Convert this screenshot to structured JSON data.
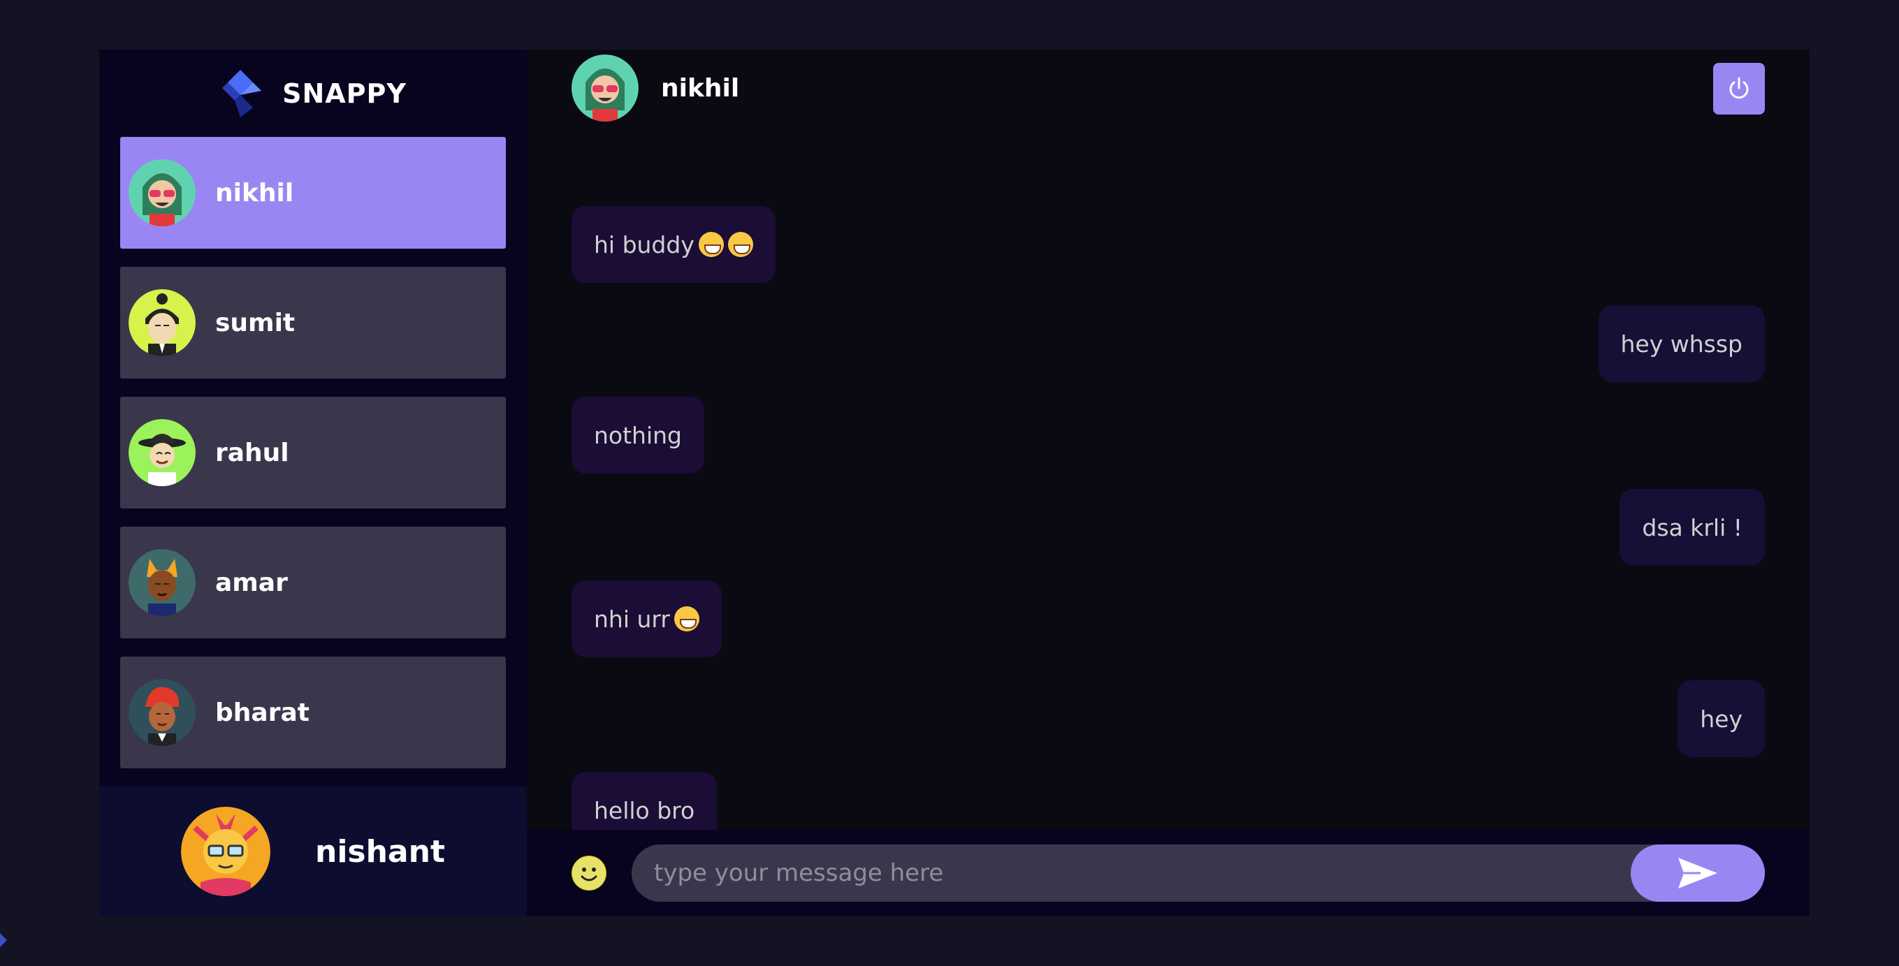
{
  "brand": {
    "name": "SNAPPY"
  },
  "contacts": [
    {
      "name": "nikhil",
      "selected": true
    },
    {
      "name": "sumit",
      "selected": false
    },
    {
      "name": "rahul",
      "selected": false
    },
    {
      "name": "amar",
      "selected": false
    },
    {
      "name": "bharat",
      "selected": false
    }
  ],
  "current_user": {
    "name": "nishant"
  },
  "chat": {
    "contact_name": "nikhil",
    "logout_icon": "power-icon",
    "messages": [
      {
        "text": "hi buddy",
        "direction": "received",
        "emojis": [
          "grin-emoji",
          "sweat-smile-emoji"
        ]
      },
      {
        "text": "hey whssp",
        "direction": "sent",
        "emojis": []
      },
      {
        "text": "nothing",
        "direction": "received",
        "emojis": []
      },
      {
        "text": "dsa krli !",
        "direction": "sent",
        "emojis": []
      },
      {
        "text": "nhi urr",
        "direction": "received",
        "emojis": [
          "sweat-smile-emoji"
        ]
      },
      {
        "text": "hey",
        "direction": "sent",
        "emojis": []
      },
      {
        "text": "hello bro",
        "direction": "received",
        "emojis": []
      }
    ]
  },
  "input": {
    "placeholder": "type your message here",
    "value": ""
  },
  "colors": {
    "accent": "#9a86f3",
    "background": "#131324",
    "sidebar": "#080420",
    "contact": "#3c3a4e"
  }
}
